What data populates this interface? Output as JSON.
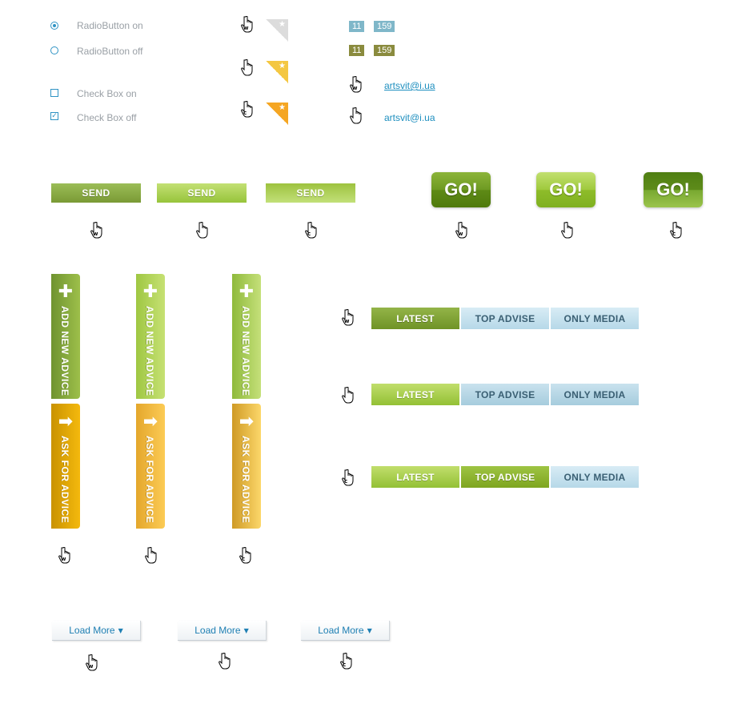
{
  "options": {
    "radio_on": "RadioButton on",
    "radio_off": "RadioButton off",
    "check_on": "Check Box on",
    "check_off": "Check Box off"
  },
  "badges": {
    "row1": [
      "11",
      "159"
    ],
    "row2": [
      "11",
      "159"
    ]
  },
  "emails": {
    "hover": "artsvit@i.ua",
    "normal": "artsvit@i.ua"
  },
  "send_buttons": [
    "SEND",
    "SEND",
    "SEND"
  ],
  "go_buttons": [
    "GO!",
    "GO!",
    "GO!"
  ],
  "vertical_tabs": {
    "add_new": "ADD NEW ADVICE",
    "ask_for": "ASK FOR ADVICE"
  },
  "tabs": [
    "LATEST",
    "TOP ADVISE",
    "ONLY MEDIA"
  ],
  "load_more": [
    "Load More",
    "Load More",
    "Load More"
  ],
  "cursor_letters": {
    "w": "w",
    "c": "c"
  },
  "colors": {
    "accent_blue": "#2f93c4",
    "green": "#7a9a35",
    "light_green": "#97c43b",
    "yellow": "#f4b90d",
    "tab_blue": "#b6d8e8"
  }
}
